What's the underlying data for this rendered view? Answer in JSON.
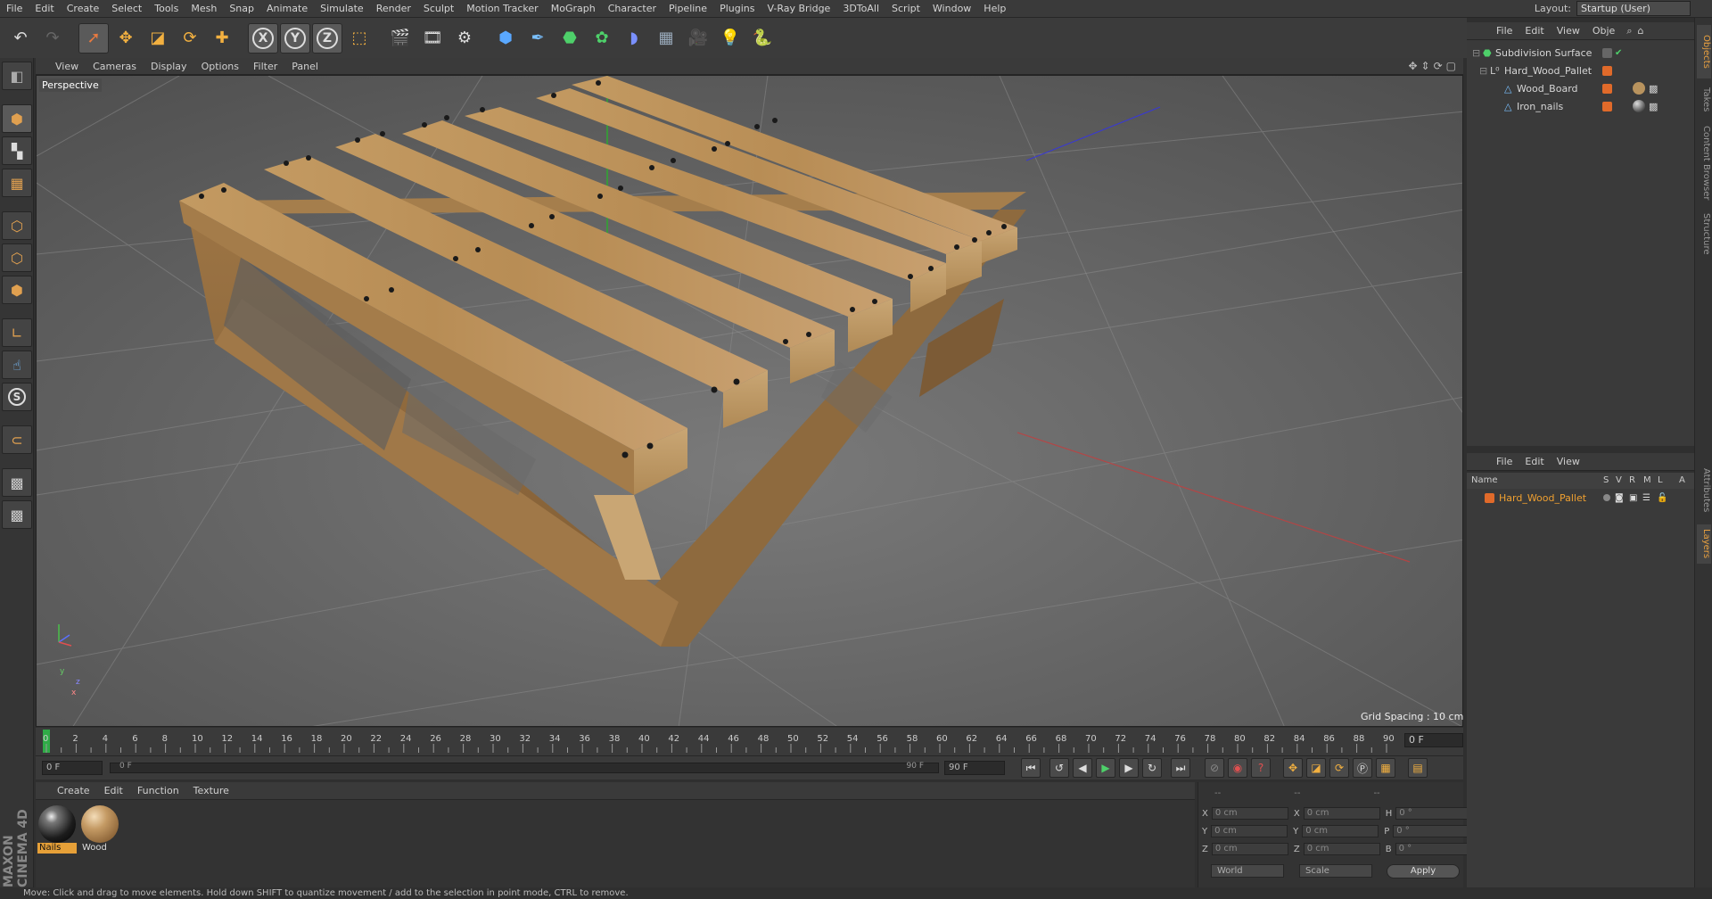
{
  "menubar": {
    "items": [
      "File",
      "Edit",
      "Create",
      "Select",
      "Tools",
      "Mesh",
      "Snap",
      "Animate",
      "Simulate",
      "Render",
      "Sculpt",
      "Motion Tracker",
      "MoGraph",
      "Character",
      "Pipeline",
      "Plugins",
      "V-Ray Bridge",
      "3DToAll",
      "Script",
      "Window",
      "Help"
    ],
    "layout_label": "Layout:",
    "layout_value": "Startup (User)"
  },
  "toolbar": {
    "icons": [
      "undo-icon",
      "redo-icon",
      "live-selection-icon",
      "move-icon",
      "scale-icon",
      "rotate-icon",
      "recent-tools-icon",
      "x-axis-icon",
      "y-axis-icon",
      "z-axis-icon",
      "coordinate-system-icon",
      "render-view-icon",
      "render-picture-viewer-icon",
      "edit-render-settings-icon",
      "cube-icon",
      "pen-icon",
      "subdivision-icon",
      "cloner-icon",
      "deformer-icon",
      "floor-icon",
      "camera-icon",
      "light-icon",
      "python-icon"
    ],
    "axis_labels": [
      "X",
      "Y",
      "Z"
    ]
  },
  "left_toolbar": {
    "icons": [
      "make-editable-icon",
      "model-mode-icon",
      "texture-mode-icon",
      "workplane-icon",
      "points-mode-icon",
      "edges-mode-icon",
      "polygons-mode-icon",
      "axis-icon",
      "tweak-icon",
      "snap-icon",
      "magnet-icon",
      "grid-lock-icon",
      "grid-snap-icon"
    ],
    "snap_letter": "S"
  },
  "viewport": {
    "menu": [
      "View",
      "Cameras",
      "Display",
      "Options",
      "Filter",
      "Panel"
    ],
    "label": "Perspective",
    "grid_spacing": "Grid Spacing : 10 cm",
    "axis_labels": [
      "y",
      "z",
      "x"
    ]
  },
  "timeline": {
    "ticks": [
      0,
      2,
      4,
      6,
      8,
      10,
      12,
      14,
      16,
      18,
      20,
      22,
      24,
      26,
      28,
      30,
      32,
      34,
      36,
      38,
      40,
      42,
      44,
      46,
      48,
      50,
      52,
      54,
      56,
      58,
      60,
      62,
      64,
      66,
      68,
      70,
      72,
      74,
      76,
      78,
      80,
      82,
      84,
      86,
      88,
      90
    ],
    "current_frame": "0 F",
    "start_field": "0 F",
    "range_start": "0 F",
    "range_end": "90 F",
    "end_field": "90 F"
  },
  "material_manager": {
    "menu": [
      "Create",
      "Edit",
      "Function",
      "Texture"
    ],
    "materials": [
      {
        "name": "Nails",
        "selected": true
      },
      {
        "name": "Wood",
        "selected": false
      }
    ]
  },
  "coordinates": {
    "head": [
      "--",
      "--",
      "--"
    ],
    "rows": [
      {
        "a": "X",
        "av": "0 cm",
        "b": "X",
        "bv": "0 cm",
        "c": "H",
        "cv": "0 °"
      },
      {
        "a": "Y",
        "av": "0 cm",
        "b": "Y",
        "bv": "0 cm",
        "c": "P",
        "cv": "0 °"
      },
      {
        "a": "Z",
        "av": "0 cm",
        "b": "Z",
        "bv": "0 cm",
        "c": "B",
        "cv": "0 °"
      }
    ],
    "world": "World",
    "scale": "Scale",
    "apply": "Apply"
  },
  "object_manager": {
    "menu": [
      "File",
      "Edit",
      "View",
      "Obje"
    ],
    "objects": [
      {
        "name": "Subdivision Surface",
        "indent": 0,
        "icon": "subdivision-surface-icon"
      },
      {
        "name": "Hard_Wood_Pallet",
        "indent": 1,
        "icon": "null-object-icon"
      },
      {
        "name": "Wood_Board",
        "indent": 2,
        "icon": "polygon-object-icon"
      },
      {
        "name": "Iron_nails",
        "indent": 2,
        "icon": "polygon-object-icon"
      }
    ]
  },
  "layer_manager": {
    "menu": [
      "File",
      "Edit",
      "View"
    ],
    "columns": [
      "Name",
      "S",
      "V",
      "R",
      "M",
      "L",
      "A"
    ],
    "layers": [
      {
        "name": "Hard_Wood_Pallet"
      }
    ]
  },
  "right_tabs": {
    "top": [
      "Objects",
      "Takes",
      "Content Browser",
      "Structure"
    ],
    "bottom": [
      "Attributes",
      "Layers"
    ]
  },
  "brand": {
    "name": "MAXON CINEMA 4D"
  },
  "status": "Move: Click and drag to move elements. Hold down SHIFT to quantize movement / add to the selection in point mode, CTRL to remove.",
  "colors": {
    "accent": "#e6a038",
    "wood": "#b88c55",
    "selection": "#f0a030"
  }
}
